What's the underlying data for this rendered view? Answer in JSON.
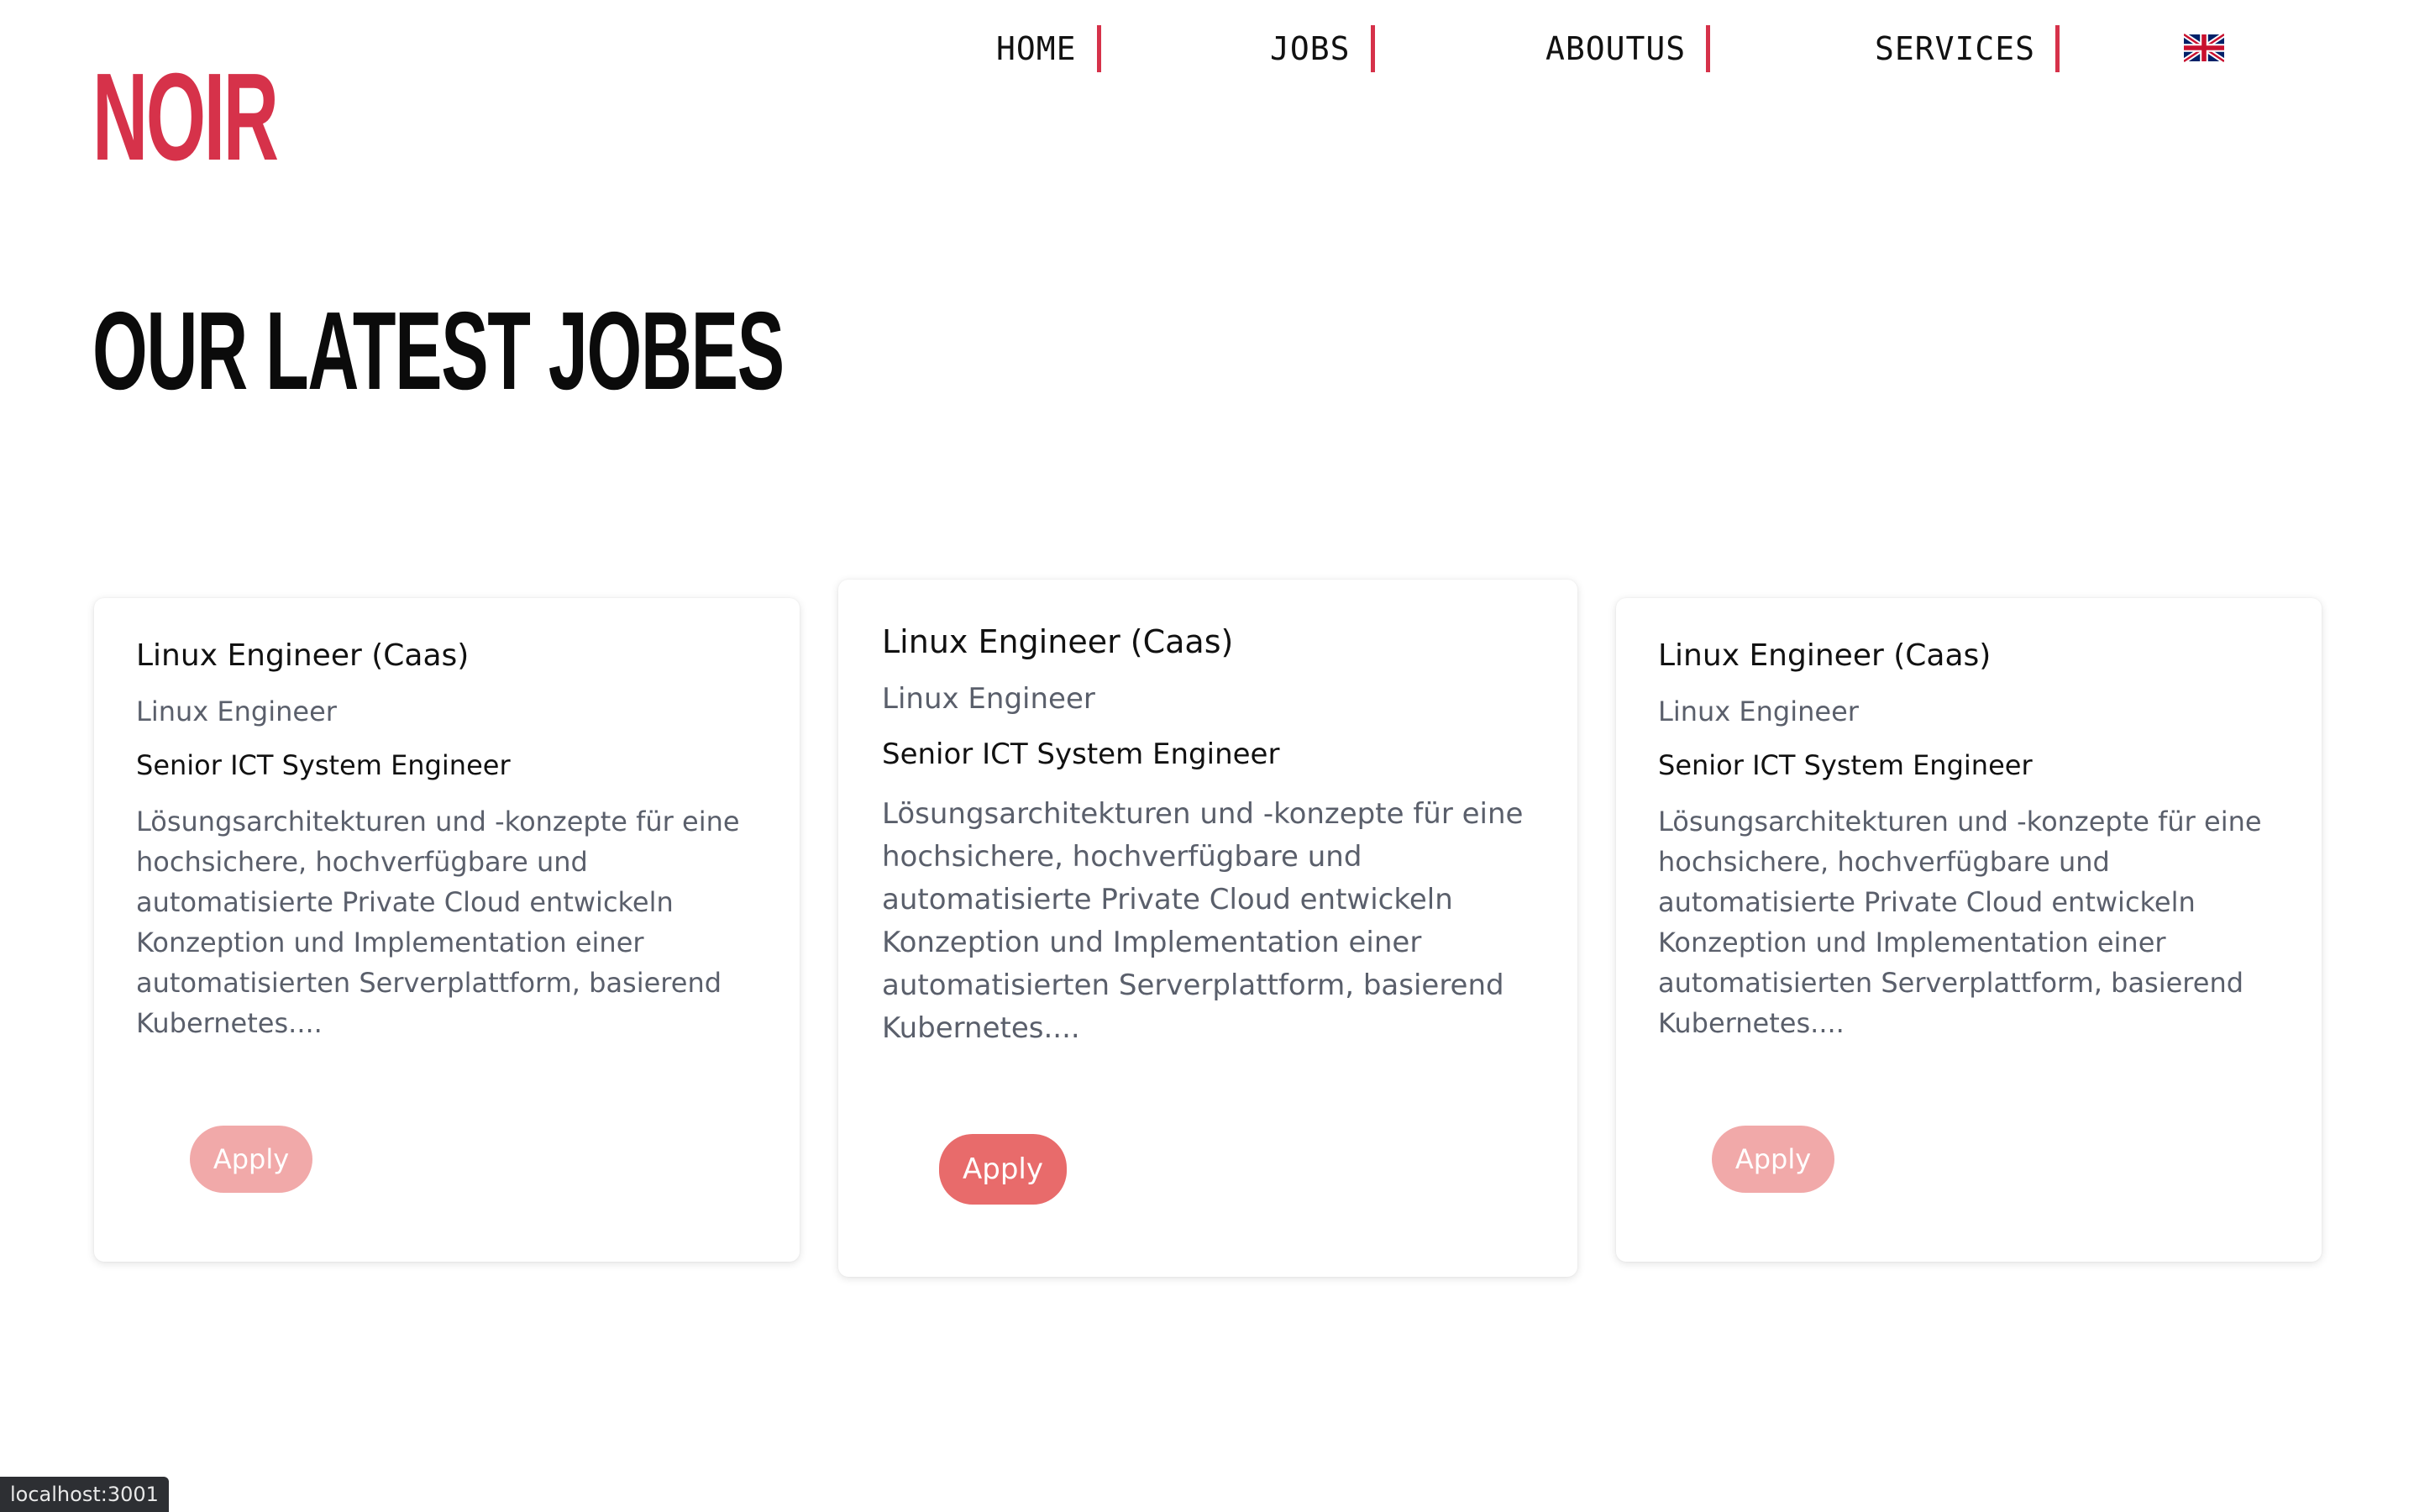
{
  "brand": {
    "logo": "NOIR",
    "accent": "#d6324a"
  },
  "nav": {
    "items": [
      {
        "label": "HOME"
      },
      {
        "label": "JOBS"
      },
      {
        "label": "ABOUTUS"
      },
      {
        "label": "SERVICES"
      }
    ],
    "language_icon": "uk-flag-icon"
  },
  "section": {
    "title": "OUR LATEST JOBES"
  },
  "jobs": [
    {
      "title": "Linux Engineer (Caas)",
      "subtitle": "Linux Engineer",
      "role": "Senior ICT System Engineer",
      "description": "Lösungsarchitekturen und -konzepte für eine hochsichere, hochverfügbare und automatisierte Private Cloud entwickeln Konzeption und Implementation einer automatisierten Serverplattform, basierend Kubernetes....",
      "apply_label": "Apply"
    },
    {
      "title": "Linux Engineer (Caas)",
      "subtitle": "Linux Engineer",
      "role": "Senior ICT System Engineer",
      "description": "Lösungsarchitekturen und -konzepte für eine hochsichere, hochverfügbare und automatisierte Private Cloud entwickeln Konzeption und Implementation einer automatisierten Serverplattform, basierend Kubernetes....",
      "apply_label": "Apply"
    },
    {
      "title": "Linux Engineer (Caas)",
      "subtitle": "Linux Engineer",
      "role": "Senior ICT System Engineer",
      "description": "Lösungsarchitekturen und -konzepte für eine hochsichere, hochverfügbare und automatisierte Private Cloud entwickeln Konzeption und Implementation einer automatisierten Serverplattform, basierend Kubernetes....",
      "apply_label": "Apply"
    }
  ],
  "statusbar": {
    "url": "localhost:3001"
  }
}
